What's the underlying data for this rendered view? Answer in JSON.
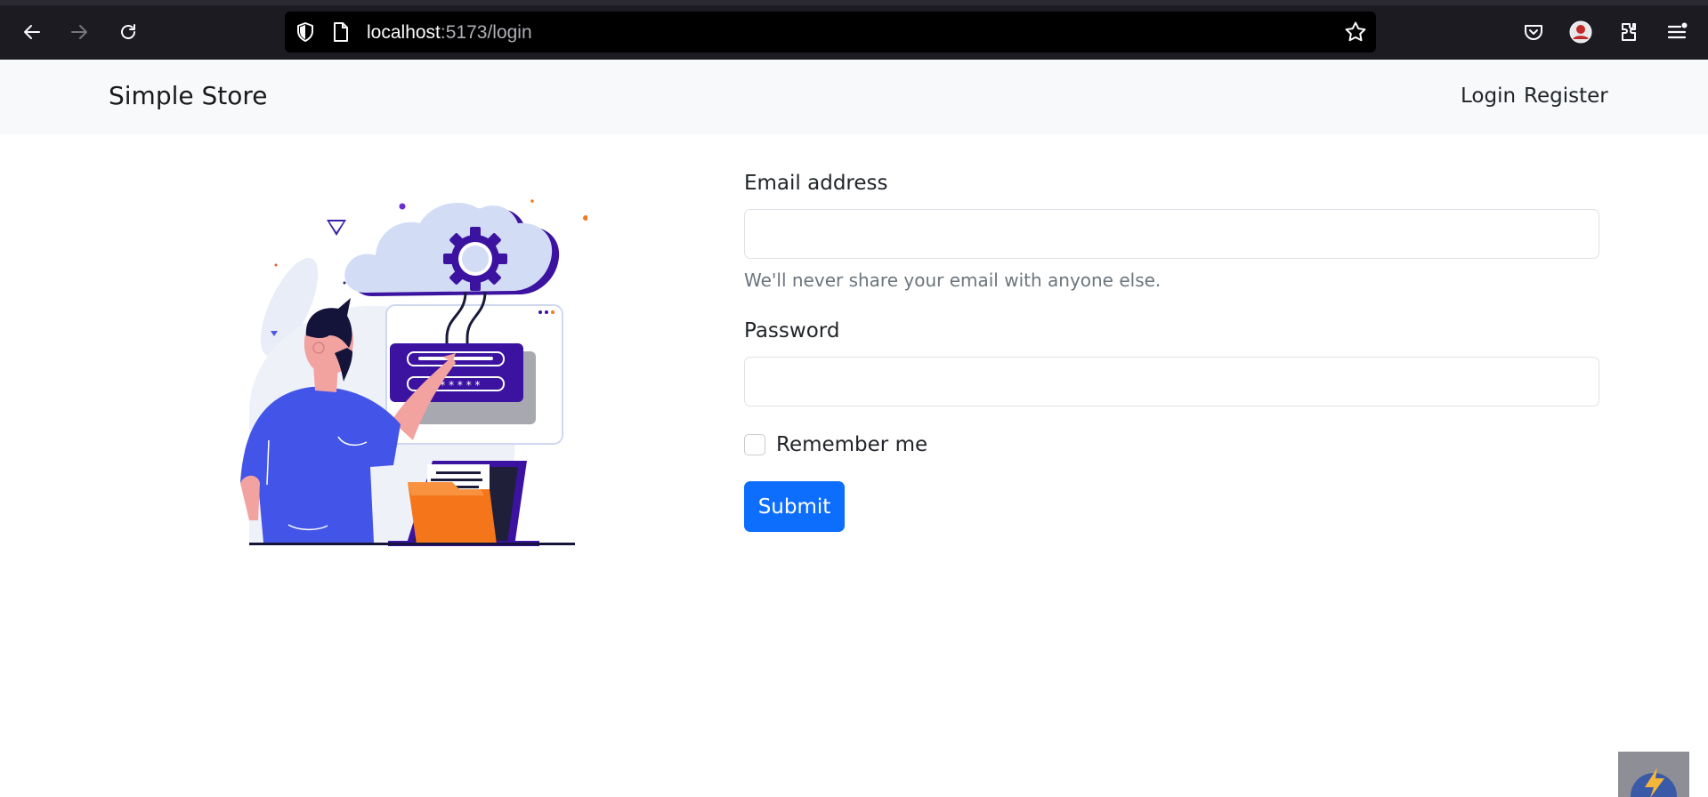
{
  "browser": {
    "url_host": "localhost",
    "url_path": ":5173/login",
    "icons": [
      "back-icon",
      "forward-icon",
      "reload-icon",
      "shield-icon",
      "page-icon",
      "bookmark-star-icon",
      "pocket-icon",
      "account-avatar-icon",
      "extensions-icon",
      "menu-icon"
    ]
  },
  "navbar": {
    "brand": "Simple Store",
    "login": "Login",
    "register": "Register",
    "background": "#f8f9fa"
  },
  "form": {
    "email_label": "Email address",
    "email_value": "",
    "email_help": "We'll never share your email with anyone else.",
    "password_label": "Password",
    "password_value": "",
    "remember_label": "Remember me",
    "submit_label": "Submit",
    "accent": "#0d6efd"
  },
  "illustration": {
    "description_icon": "login-illustration",
    "password_mask": "* * * * * *"
  }
}
